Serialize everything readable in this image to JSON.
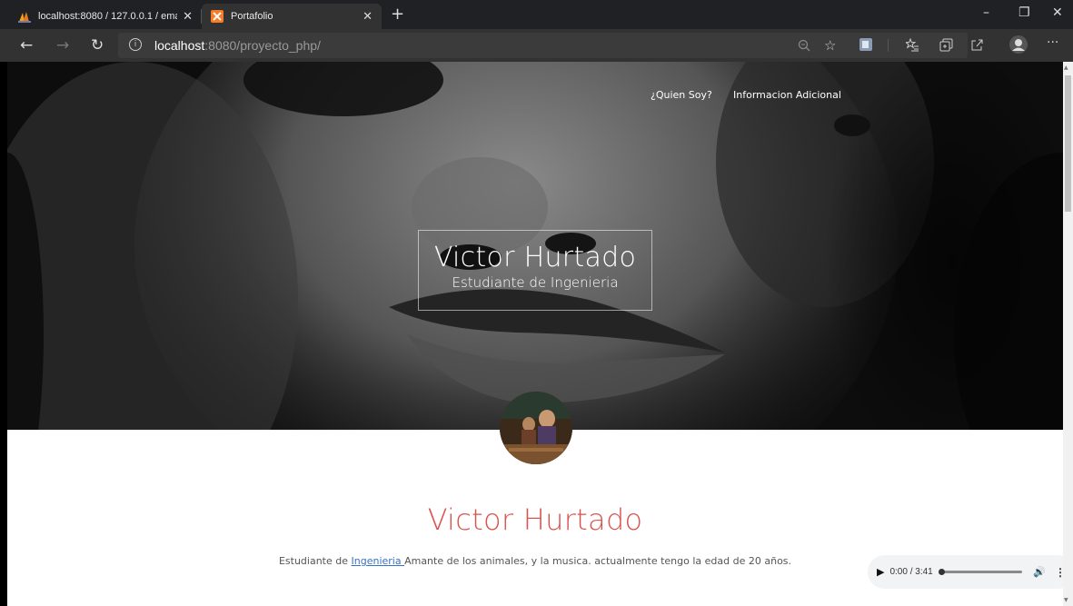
{
  "browser": {
    "tabs": [
      {
        "label": "localhost:8080 / 127.0.0.1 / emai",
        "icon": "phpmyadmin-icon",
        "active": false
      },
      {
        "label": "Portafolio",
        "icon": "xampp-icon",
        "active": true
      }
    ],
    "new_tab": "+",
    "window_controls": {
      "minimize": "–",
      "restore": "❐",
      "close": "✕"
    },
    "nav": {
      "back": "←",
      "forward": "→",
      "refresh": "↻"
    },
    "address": {
      "host": "localhost",
      "rest": ":8080/proyecto_php/"
    },
    "toolbar_icons": [
      "zoom-icon",
      "favorite-star-icon",
      "extension-icon",
      "favorites-bar-icon",
      "collections-icon",
      "share-icon",
      "profile-avatar-icon",
      "more-menu-icon"
    ],
    "more": "···"
  },
  "page": {
    "nav": {
      "item1": "¿Quien Soy?",
      "item2": "Informacion Adicional"
    },
    "hero": {
      "name": "Victor Hurtado",
      "subtitle": "Estudiante de Ingenieria"
    },
    "about": {
      "name": "Victor Hurtado",
      "desc_prefix": "Estudiante de ",
      "desc_link": "Ingenieria ",
      "desc_suffix": "Amante de los animales, y la musica. actualmente tengo la edad de 20 años."
    },
    "audio": {
      "play": "▶",
      "time": "0:00 / 3:41",
      "progress": 0,
      "volume": "🔊",
      "menu": "⋮"
    }
  },
  "colors": {
    "accent": "#d9534f",
    "link": "#3771c8",
    "chrome_bg": "#202124",
    "toolbar_bg": "#323232"
  }
}
